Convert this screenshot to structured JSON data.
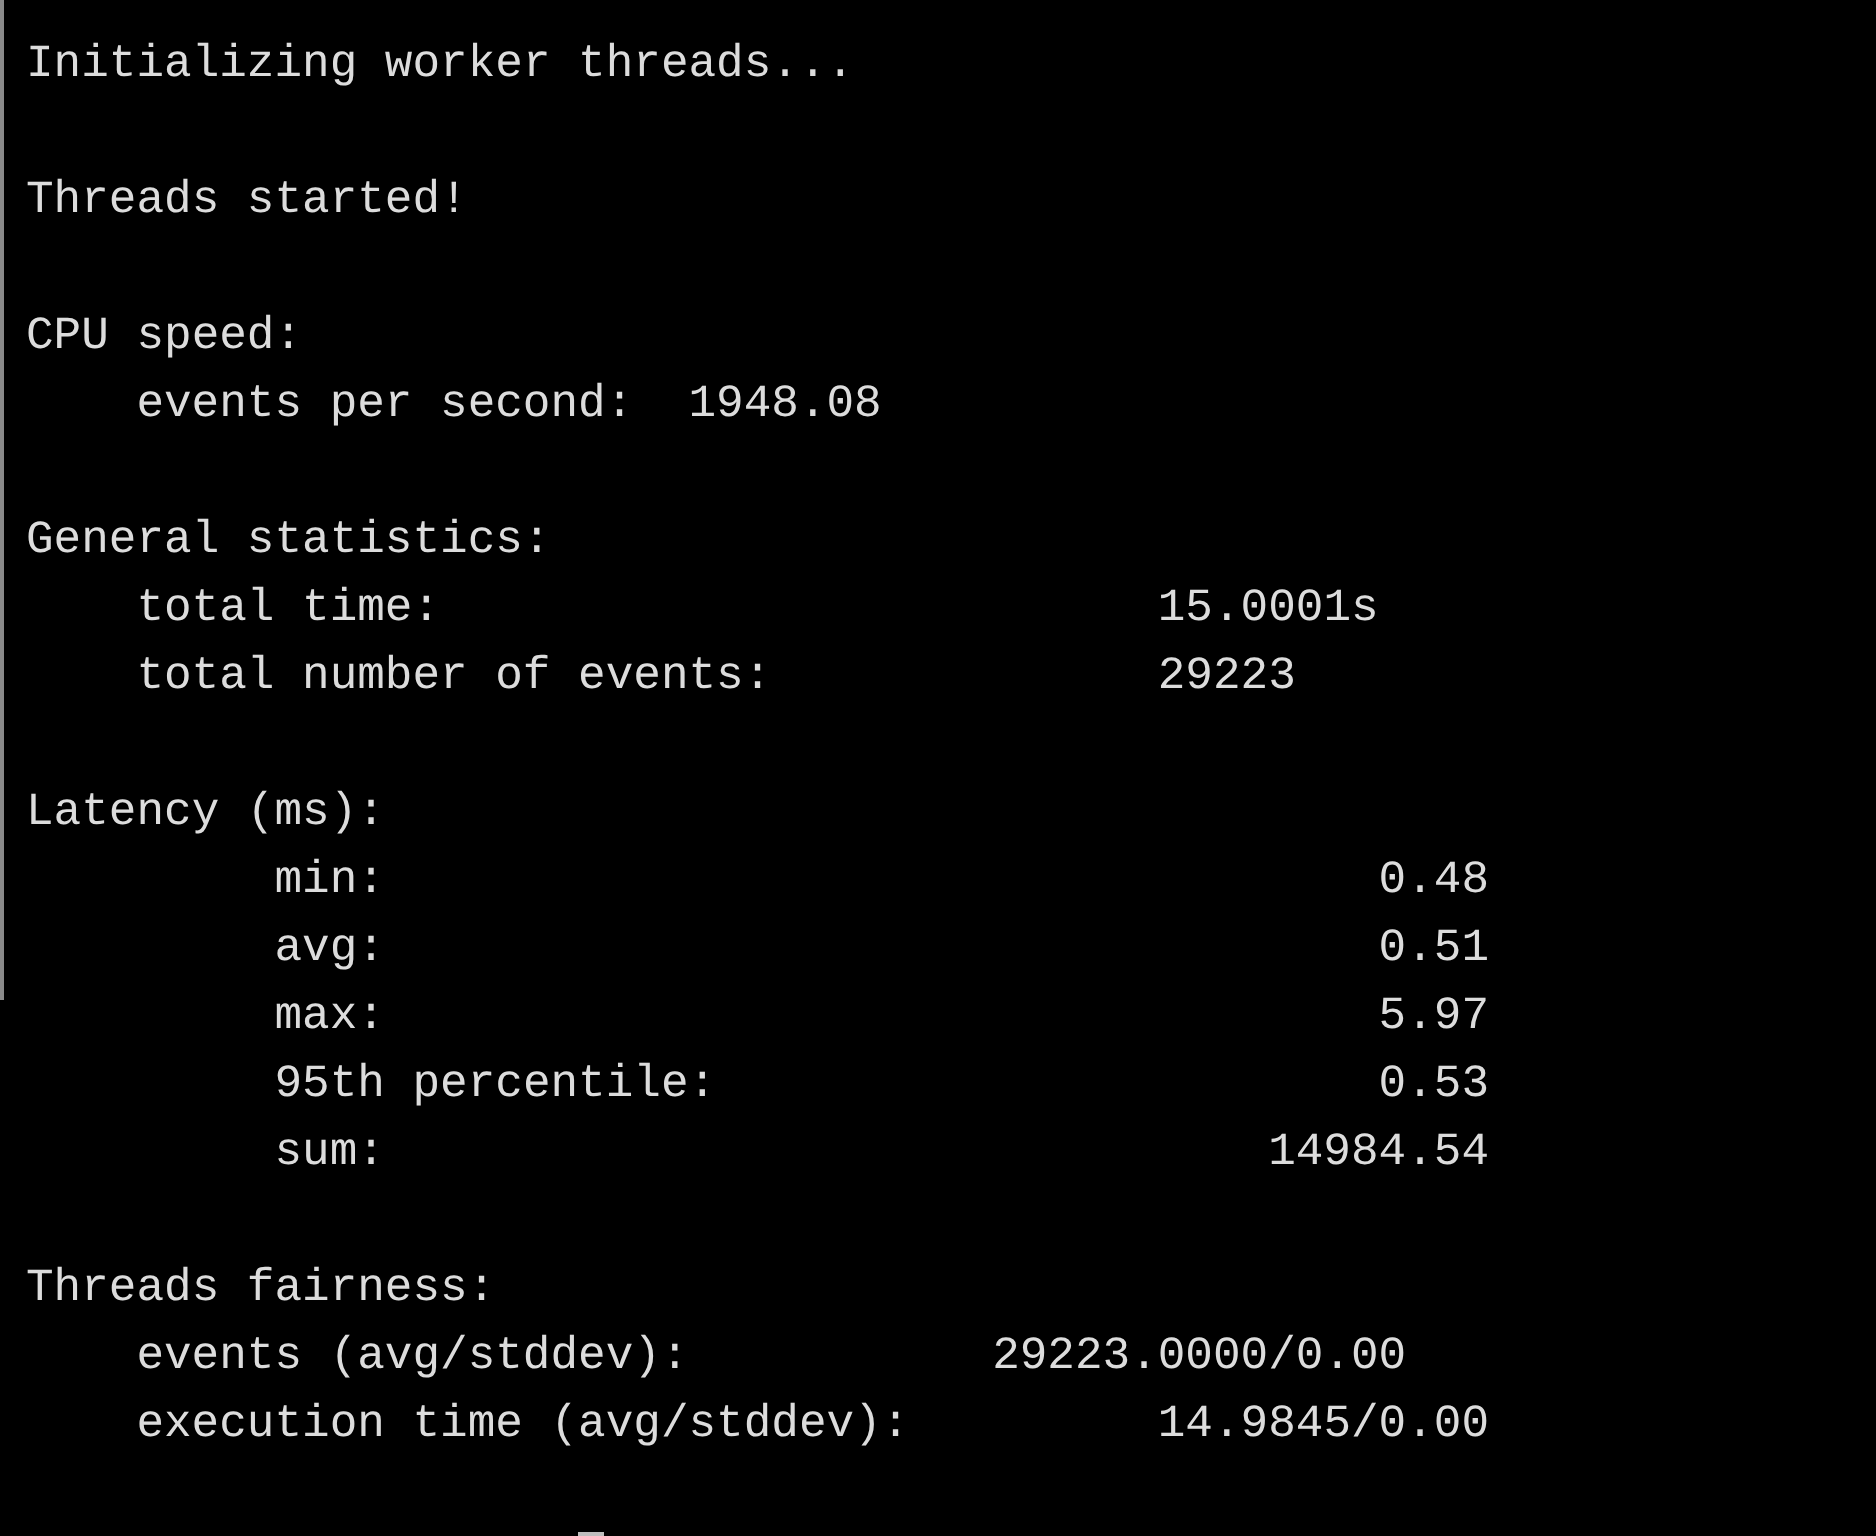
{
  "terminal": {
    "blocks": [
      {
        "kind": "message",
        "heading": "Initializing worker threads..."
      },
      {
        "kind": "message",
        "heading": "Threads started!"
      },
      {
        "kind": "cpu",
        "heading": "CPU speed:",
        "rows": [
          {
            "label": "events per second:",
            "value": "1948.08"
          }
        ]
      },
      {
        "kind": "general",
        "heading": "General statistics:",
        "rows": [
          {
            "label": "total time:",
            "value": "15.0001s"
          },
          {
            "label": "total number of events:",
            "value": "29223"
          }
        ]
      },
      {
        "kind": "latency",
        "heading": "Latency (ms):",
        "rows": [
          {
            "label": "min:",
            "value": "0.48"
          },
          {
            "label": "avg:",
            "value": "0.51"
          },
          {
            "label": "max:",
            "value": "5.97"
          },
          {
            "label": "95th percentile:",
            "value": "0.53"
          },
          {
            "label": "sum:",
            "value": "14984.54"
          }
        ]
      },
      {
        "kind": "fairness",
        "heading": "Threads fairness:",
        "rows": [
          {
            "label": "events (avg/stddev):",
            "value": "29223.0000/0.00"
          },
          {
            "label": "execution time (avg/stddev):",
            "value": "14.9845/0.00"
          }
        ]
      }
    ]
  }
}
